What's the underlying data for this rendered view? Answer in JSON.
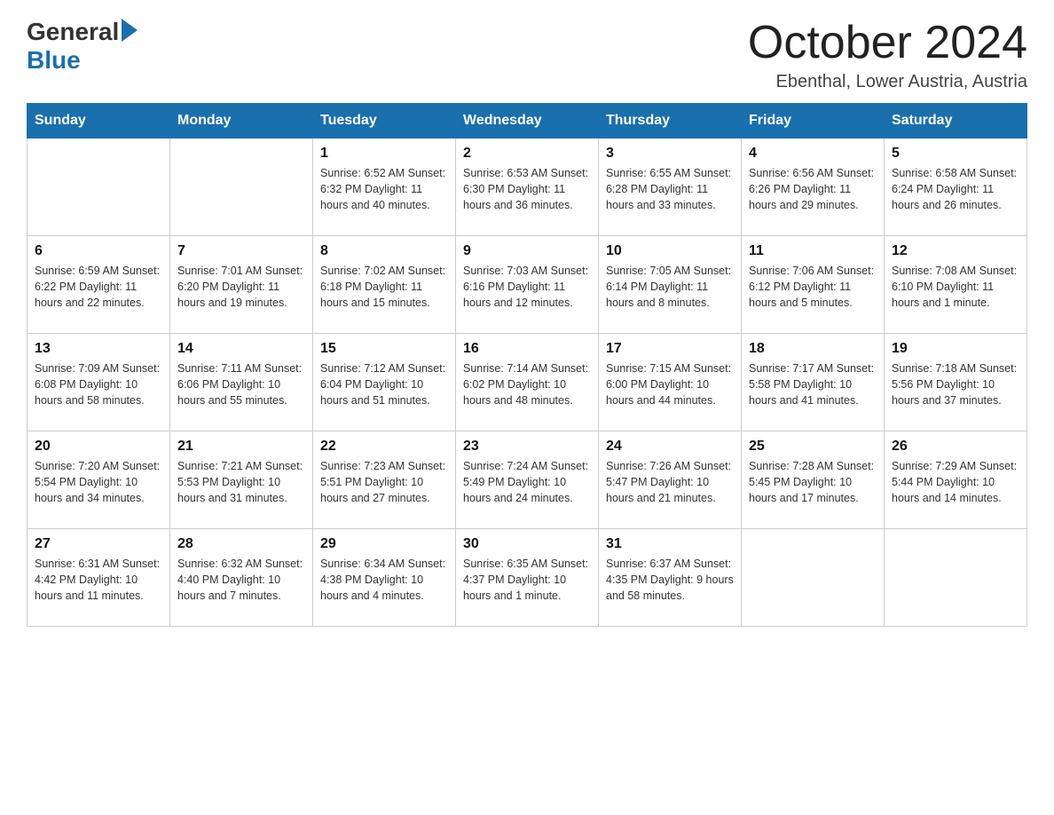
{
  "header": {
    "logo_general": "General",
    "logo_blue": "Blue",
    "month_title": "October 2024",
    "location": "Ebenthal, Lower Austria, Austria"
  },
  "days_of_week": [
    "Sunday",
    "Monday",
    "Tuesday",
    "Wednesday",
    "Thursday",
    "Friday",
    "Saturday"
  ],
  "weeks": [
    [
      {
        "day": "",
        "info": ""
      },
      {
        "day": "",
        "info": ""
      },
      {
        "day": "1",
        "info": "Sunrise: 6:52 AM\nSunset: 6:32 PM\nDaylight: 11 hours\nand 40 minutes."
      },
      {
        "day": "2",
        "info": "Sunrise: 6:53 AM\nSunset: 6:30 PM\nDaylight: 11 hours\nand 36 minutes."
      },
      {
        "day": "3",
        "info": "Sunrise: 6:55 AM\nSunset: 6:28 PM\nDaylight: 11 hours\nand 33 minutes."
      },
      {
        "day": "4",
        "info": "Sunrise: 6:56 AM\nSunset: 6:26 PM\nDaylight: 11 hours\nand 29 minutes."
      },
      {
        "day": "5",
        "info": "Sunrise: 6:58 AM\nSunset: 6:24 PM\nDaylight: 11 hours\nand 26 minutes."
      }
    ],
    [
      {
        "day": "6",
        "info": "Sunrise: 6:59 AM\nSunset: 6:22 PM\nDaylight: 11 hours\nand 22 minutes."
      },
      {
        "day": "7",
        "info": "Sunrise: 7:01 AM\nSunset: 6:20 PM\nDaylight: 11 hours\nand 19 minutes."
      },
      {
        "day": "8",
        "info": "Sunrise: 7:02 AM\nSunset: 6:18 PM\nDaylight: 11 hours\nand 15 minutes."
      },
      {
        "day": "9",
        "info": "Sunrise: 7:03 AM\nSunset: 6:16 PM\nDaylight: 11 hours\nand 12 minutes."
      },
      {
        "day": "10",
        "info": "Sunrise: 7:05 AM\nSunset: 6:14 PM\nDaylight: 11 hours\nand 8 minutes."
      },
      {
        "day": "11",
        "info": "Sunrise: 7:06 AM\nSunset: 6:12 PM\nDaylight: 11 hours\nand 5 minutes."
      },
      {
        "day": "12",
        "info": "Sunrise: 7:08 AM\nSunset: 6:10 PM\nDaylight: 11 hours\nand 1 minute."
      }
    ],
    [
      {
        "day": "13",
        "info": "Sunrise: 7:09 AM\nSunset: 6:08 PM\nDaylight: 10 hours\nand 58 minutes."
      },
      {
        "day": "14",
        "info": "Sunrise: 7:11 AM\nSunset: 6:06 PM\nDaylight: 10 hours\nand 55 minutes."
      },
      {
        "day": "15",
        "info": "Sunrise: 7:12 AM\nSunset: 6:04 PM\nDaylight: 10 hours\nand 51 minutes."
      },
      {
        "day": "16",
        "info": "Sunrise: 7:14 AM\nSunset: 6:02 PM\nDaylight: 10 hours\nand 48 minutes."
      },
      {
        "day": "17",
        "info": "Sunrise: 7:15 AM\nSunset: 6:00 PM\nDaylight: 10 hours\nand 44 minutes."
      },
      {
        "day": "18",
        "info": "Sunrise: 7:17 AM\nSunset: 5:58 PM\nDaylight: 10 hours\nand 41 minutes."
      },
      {
        "day": "19",
        "info": "Sunrise: 7:18 AM\nSunset: 5:56 PM\nDaylight: 10 hours\nand 37 minutes."
      }
    ],
    [
      {
        "day": "20",
        "info": "Sunrise: 7:20 AM\nSunset: 5:54 PM\nDaylight: 10 hours\nand 34 minutes."
      },
      {
        "day": "21",
        "info": "Sunrise: 7:21 AM\nSunset: 5:53 PM\nDaylight: 10 hours\nand 31 minutes."
      },
      {
        "day": "22",
        "info": "Sunrise: 7:23 AM\nSunset: 5:51 PM\nDaylight: 10 hours\nand 27 minutes."
      },
      {
        "day": "23",
        "info": "Sunrise: 7:24 AM\nSunset: 5:49 PM\nDaylight: 10 hours\nand 24 minutes."
      },
      {
        "day": "24",
        "info": "Sunrise: 7:26 AM\nSunset: 5:47 PM\nDaylight: 10 hours\nand 21 minutes."
      },
      {
        "day": "25",
        "info": "Sunrise: 7:28 AM\nSunset: 5:45 PM\nDaylight: 10 hours\nand 17 minutes."
      },
      {
        "day": "26",
        "info": "Sunrise: 7:29 AM\nSunset: 5:44 PM\nDaylight: 10 hours\nand 14 minutes."
      }
    ],
    [
      {
        "day": "27",
        "info": "Sunrise: 6:31 AM\nSunset: 4:42 PM\nDaylight: 10 hours\nand 11 minutes."
      },
      {
        "day": "28",
        "info": "Sunrise: 6:32 AM\nSunset: 4:40 PM\nDaylight: 10 hours\nand 7 minutes."
      },
      {
        "day": "29",
        "info": "Sunrise: 6:34 AM\nSunset: 4:38 PM\nDaylight: 10 hours\nand 4 minutes."
      },
      {
        "day": "30",
        "info": "Sunrise: 6:35 AM\nSunset: 4:37 PM\nDaylight: 10 hours\nand 1 minute."
      },
      {
        "day": "31",
        "info": "Sunrise: 6:37 AM\nSunset: 4:35 PM\nDaylight: 9 hours\nand 58 minutes."
      },
      {
        "day": "",
        "info": ""
      },
      {
        "day": "",
        "info": ""
      }
    ]
  ]
}
